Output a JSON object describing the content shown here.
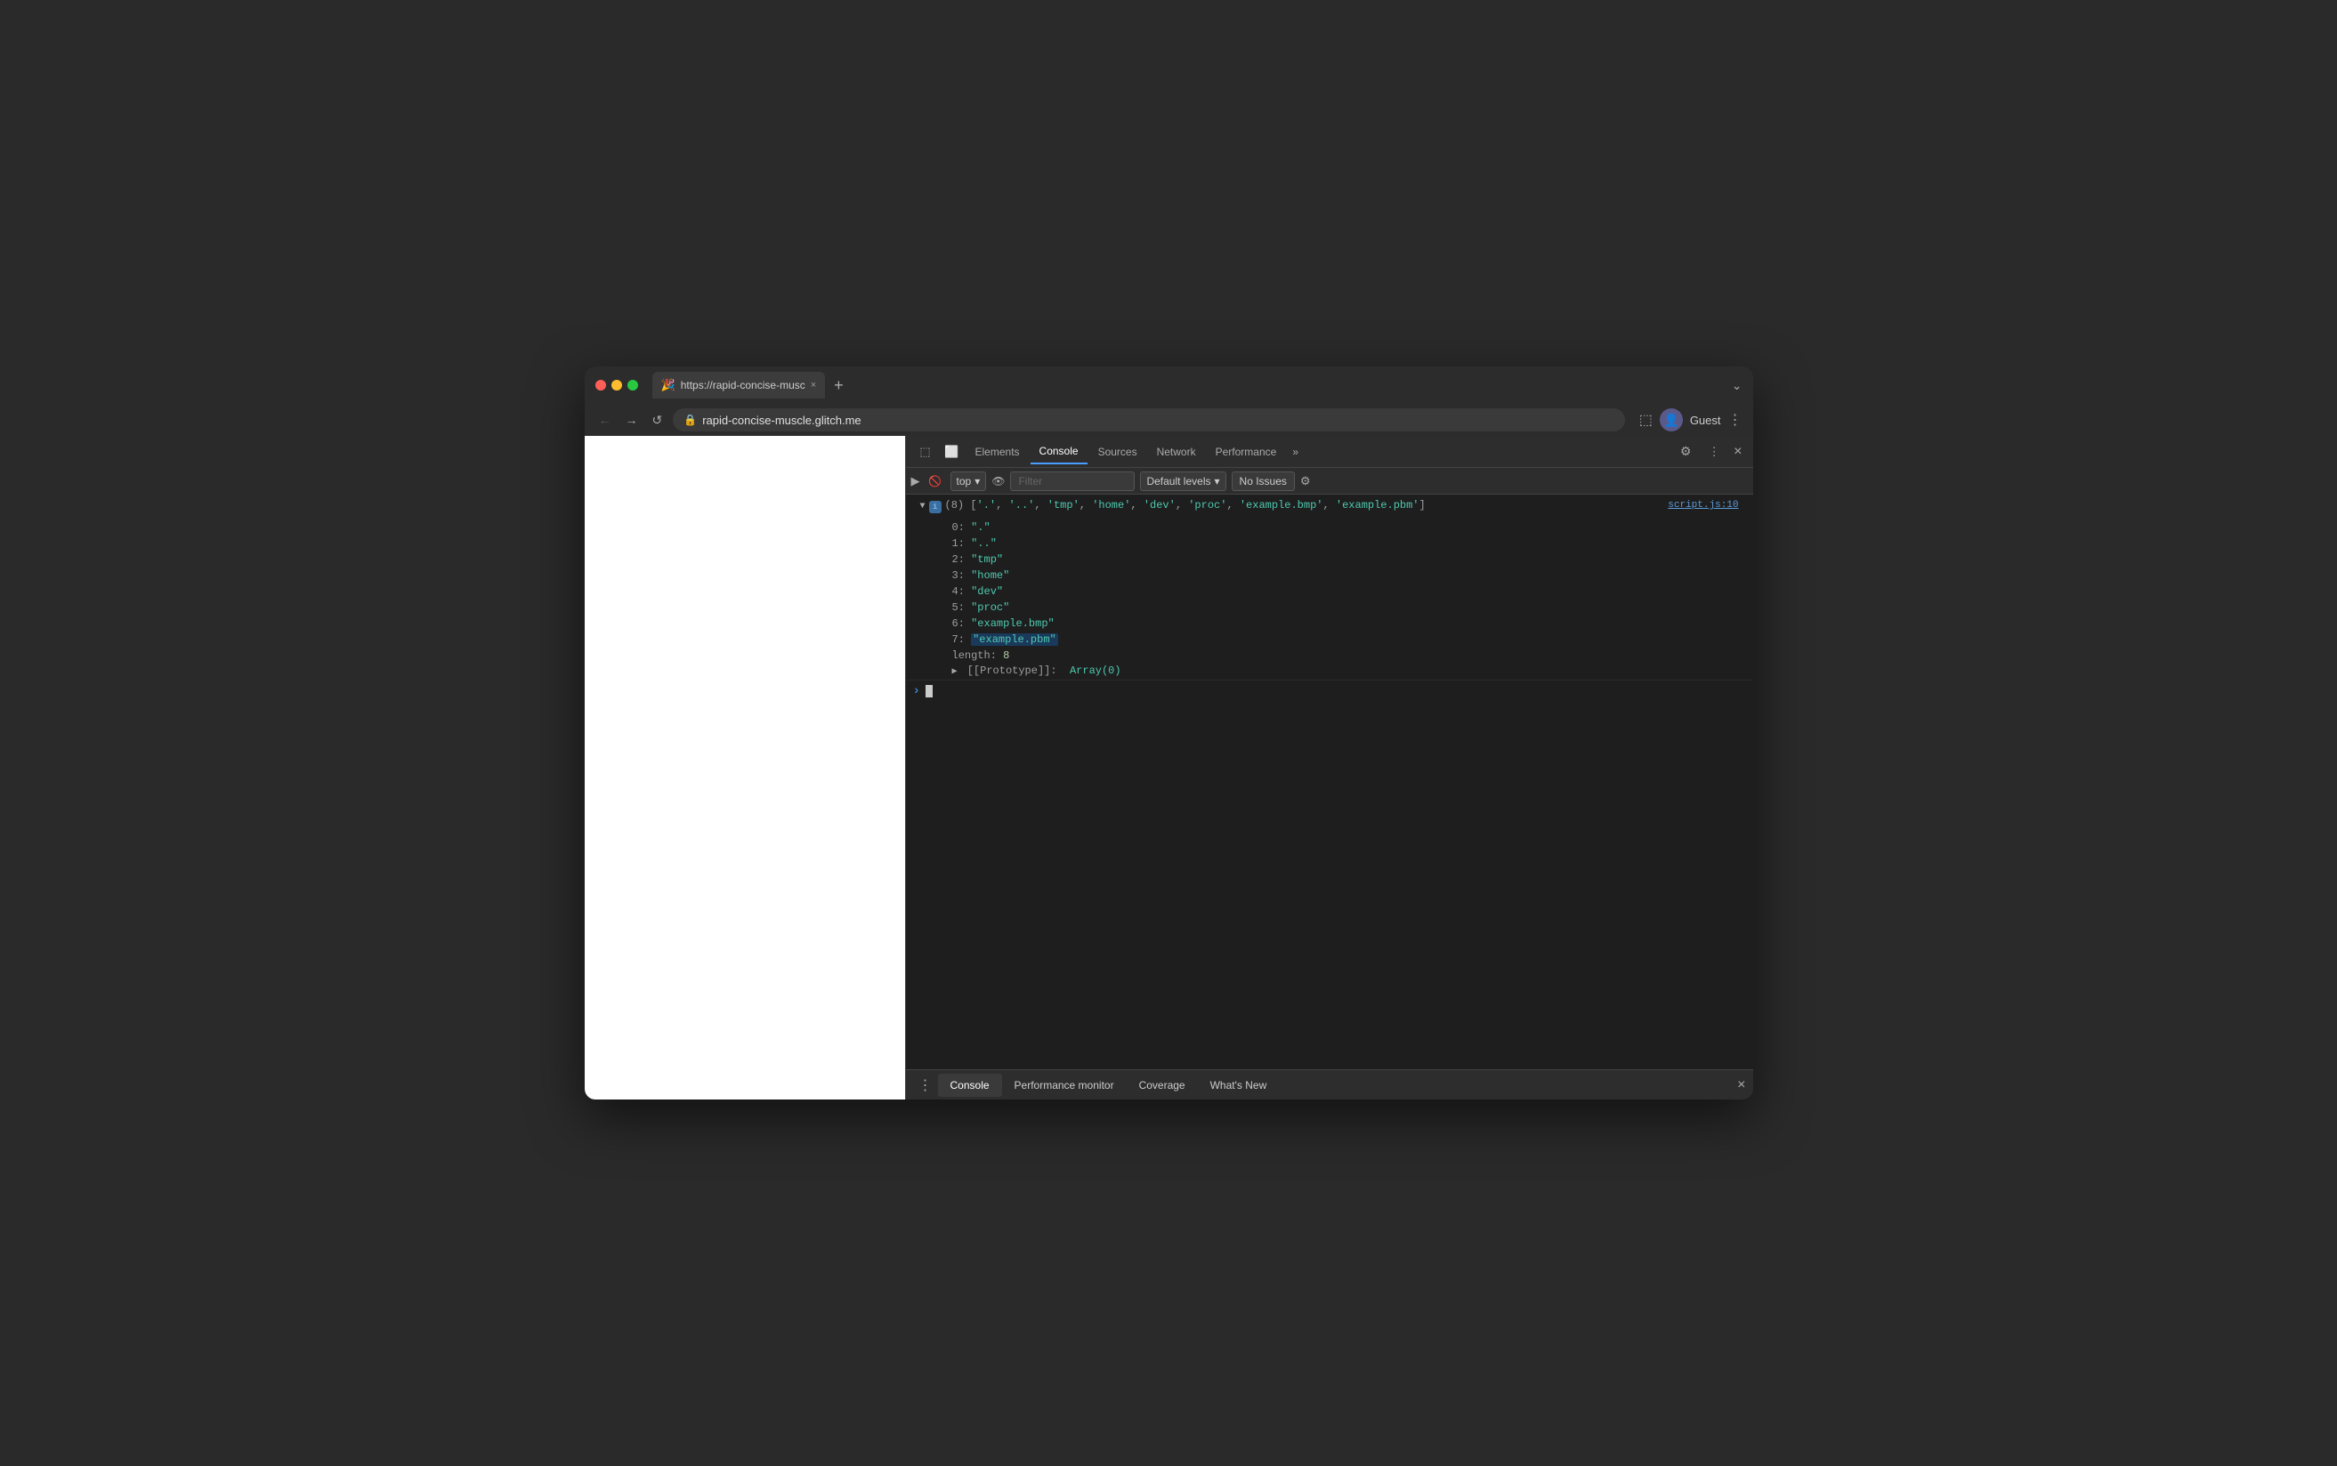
{
  "browser": {
    "tab_url": "https://rapid-concise-muscle.g...",
    "tab_close": "×",
    "new_tab": "+",
    "chevron": "⌄",
    "address": "rapid-concise-muscle.glitch.me",
    "nav_back": "←",
    "nav_forward": "→",
    "nav_reload": "↺",
    "lock_icon": "🔒",
    "profile_icon": "👤",
    "profile_name": "Guest",
    "menu_icon": "⋮",
    "devtools_toggle": "▣"
  },
  "devtools": {
    "tabs": [
      {
        "label": "Elements",
        "active": false
      },
      {
        "label": "Console",
        "active": true
      },
      {
        "label": "Sources",
        "active": false
      },
      {
        "label": "Network",
        "active": false
      },
      {
        "label": "Performance",
        "active": false
      }
    ],
    "more_tabs": "»",
    "settings_icon": "⚙",
    "more_icon": "⋮",
    "close_icon": "×",
    "inspect_icon": "⬚",
    "device_icon": "⬜",
    "secondary": {
      "exec_icon": "▶",
      "clear_icon": "🚫",
      "top_label": "top",
      "top_arrow": "▾",
      "eye_icon": "👁",
      "filter_placeholder": "Filter",
      "default_levels": "Default levels",
      "default_levels_arrow": "▾",
      "no_issues": "No Issues",
      "settings_icon": "⚙"
    },
    "console": {
      "source_link": "script.js:10",
      "array_summary": "(8) ['.', '..', 'tmp', 'home', 'dev', 'proc', 'example.bmp', 'example.pbm']",
      "entries": [
        {
          "key": "0:",
          "val": "\".\"",
          "highlight": false
        },
        {
          "key": "1:",
          "val": "\"..\"",
          "highlight": false
        },
        {
          "key": "2:",
          "val": "\"tmp\"",
          "highlight": false
        },
        {
          "key": "3:",
          "val": "\"home\"",
          "highlight": false
        },
        {
          "key": "4:",
          "val": "\"dev\"",
          "highlight": false
        },
        {
          "key": "5:",
          "val": "\"proc\"",
          "highlight": false
        },
        {
          "key": "6:",
          "val": "\"example.bmp\"",
          "highlight": false
        },
        {
          "key": "7:",
          "val": "\"example.pbm\"",
          "highlight": true
        }
      ],
      "length_key": "length:",
      "length_val": "8",
      "proto_key": "[[Prototype]]:",
      "proto_val": "Array(0)"
    },
    "bottom_tabs": [
      {
        "label": "Console",
        "active": true
      },
      {
        "label": "Performance monitor",
        "active": false
      },
      {
        "label": "Coverage",
        "active": false
      },
      {
        "label": "What's New",
        "active": false
      }
    ],
    "bottom_close": "×"
  }
}
